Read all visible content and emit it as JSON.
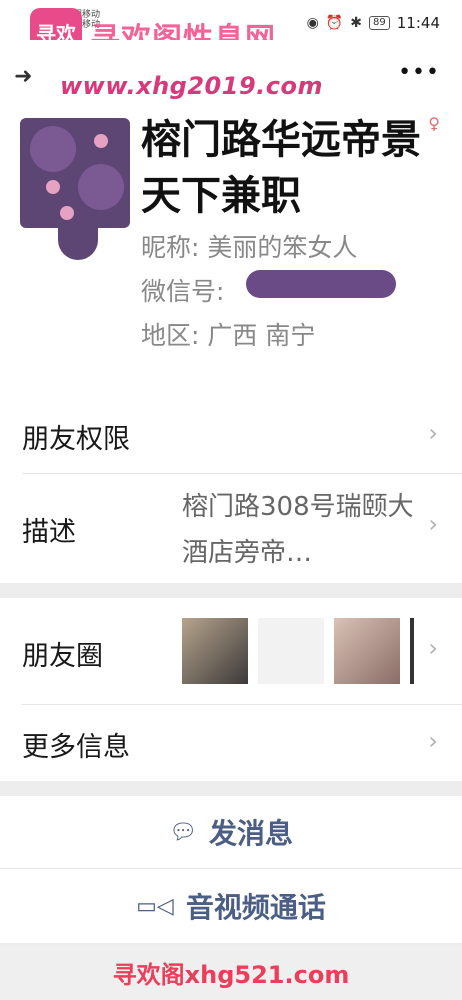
{
  "status_bar": {
    "carrier_1": "中国移动",
    "carrier_2": "中国移动",
    "battery": "89",
    "time": "11:44"
  },
  "watermark": {
    "logo_text": "寻欢",
    "title": "寻欢阁性息网",
    "url": "www.xhg2019.com",
    "bottom": "寻欢阁xhg521.com"
  },
  "profile": {
    "display_name": "榕门路华远帝景天下兼职",
    "nickname": "昵称: 美丽的笨女人",
    "wechat_id_label": "微信号:",
    "region": "地区: 广西  南宁"
  },
  "rows": {
    "permissions": "朋友权限",
    "description_label": "描述",
    "description_value": "榕门路308号瑞颐大酒店旁帝…",
    "moments": "朋友圈",
    "more_info": "更多信息"
  },
  "actions": {
    "message": "发消息",
    "call": "音视频通话"
  },
  "icons": {
    "back": "back-icon",
    "more": "more-icon",
    "chevron": "chevron-right-icon",
    "message": "chat-bubble-icon",
    "call": "video-camera-icon",
    "gender": "female-icon"
  },
  "colors": {
    "accent": "#4b5e85",
    "watermark": "#f04a86",
    "background": "#ededed"
  }
}
